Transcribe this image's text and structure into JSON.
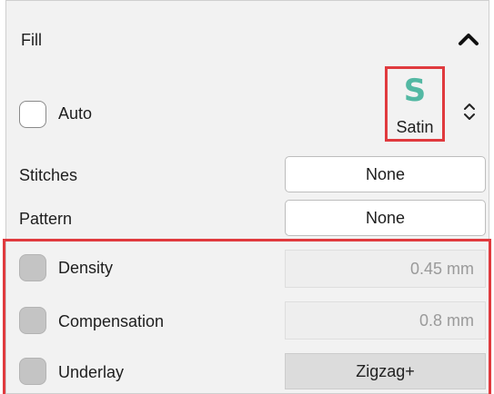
{
  "fill_section": {
    "title": "Fill",
    "collapse_icon": "chevron-up-icon",
    "auto": {
      "label": "Auto",
      "checked": false
    },
    "stitch_type": {
      "icon": "satin-stitch-icon",
      "glyph": "S",
      "label": "Satin",
      "glyph_color": "#53b8a3"
    },
    "stitch_type_spin_icon": "spin-up-down-icon",
    "stitches": {
      "label": "Stitches",
      "value": "None"
    },
    "pattern": {
      "label": "Pattern",
      "value": "None"
    },
    "density": {
      "label": "Density",
      "value": "0.45 mm",
      "checked": false
    },
    "compensation": {
      "label": "Compensation",
      "value": "0.8 mm",
      "checked": false
    },
    "underlay": {
      "label": "Underlay",
      "value": "Zigzag+",
      "checked": false
    }
  },
  "colors": {
    "highlight": "#e03a3e",
    "panel_background": "#f2f2f2"
  }
}
